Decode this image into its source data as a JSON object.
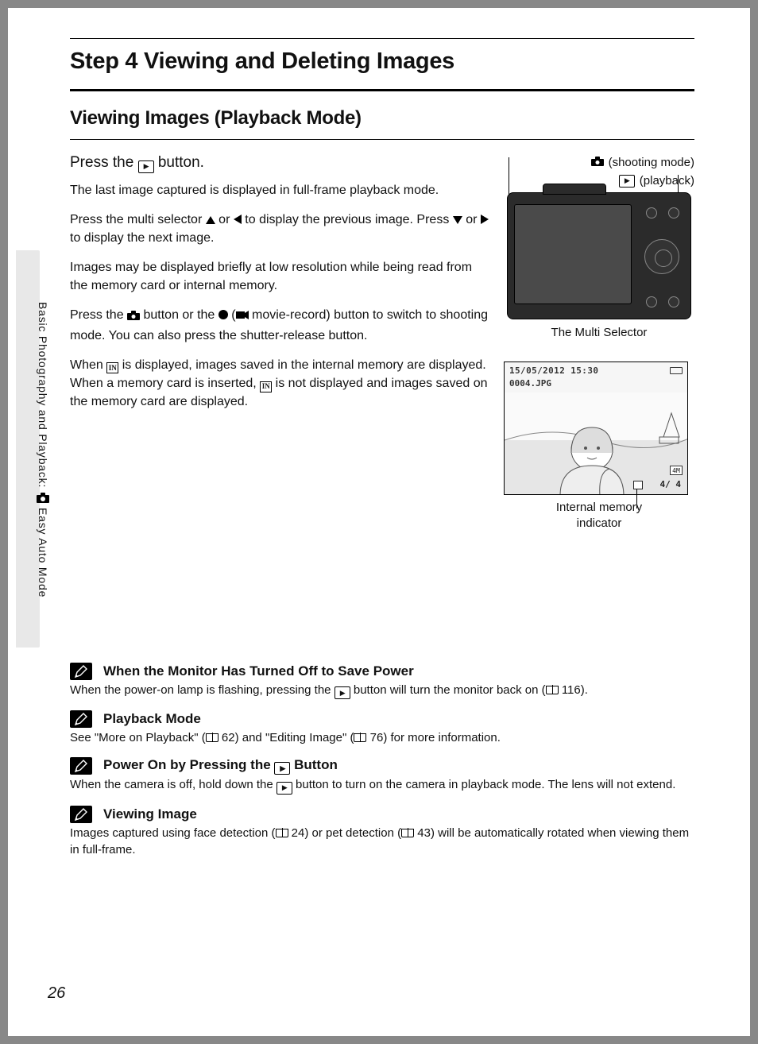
{
  "pageNumber": "26",
  "sideLabel": {
    "pre": "Basic Photography and Playback: ",
    "post": " Easy Auto Mode"
  },
  "h1": "Step 4 Viewing and Deleting Images",
  "h2": "Viewing Images (Playback Mode)",
  "h3_pre": "Press the ",
  "h3_post": " button.",
  "p1": "The last image captured is displayed in full-frame playback mode.",
  "p2a": "Press the multi selector ",
  "p2b": " or ",
  "p2c": " to display the previous image. Press ",
  "p2d": " or ",
  "p2e": " to display the next image.",
  "p3": "Images may be displayed briefly at low resolution while being read from the memory card or internal memory.",
  "p4a": "Press the ",
  "p4b": " button or the ",
  "p4c": " (",
  "p4d": " movie-record) button to switch to shooting mode. You can also press the shutter-release button.",
  "p5a": "When ",
  "p5b": " is displayed, images saved in the internal memory are displayed. When a memory card is inserted, ",
  "p5c": " is not displayed and images saved on the memory card are displayed.",
  "diagram": {
    "shooting": " (shooting mode)",
    "playback": " (playback)",
    "multiSelector": "The Multi Selector",
    "internalMem1": "Internal memory",
    "internalMem2": "indicator"
  },
  "preview": {
    "datetime": "15/05/2012 15:30",
    "filename": "0004.JPG",
    "size": "4M",
    "count": "4/    4"
  },
  "notes": [
    {
      "title": "When the Monitor Has Turned Off to Save Power",
      "body_a": "When the power-on lamp is flashing, pressing the ",
      "body_b": " button will turn the monitor back on (",
      "body_c": " 116)."
    },
    {
      "title": "Playback Mode",
      "body_a": "See \"More on Playback\" (",
      "body_b": " 62) and \"Editing Image\" (",
      "body_c": " 76) for more information."
    },
    {
      "title_a": "Power On by Pressing the ",
      "title_b": " Button",
      "body_a": "When the camera is off, hold down the ",
      "body_b": " button to turn on the camera in playback mode. The lens will not extend."
    },
    {
      "title": "Viewing Image",
      "body_a": "Images captured using face detection (",
      "body_b": " 24) or pet detection (",
      "body_c": " 43) will be automatically rotated when viewing them in full-frame."
    }
  ]
}
